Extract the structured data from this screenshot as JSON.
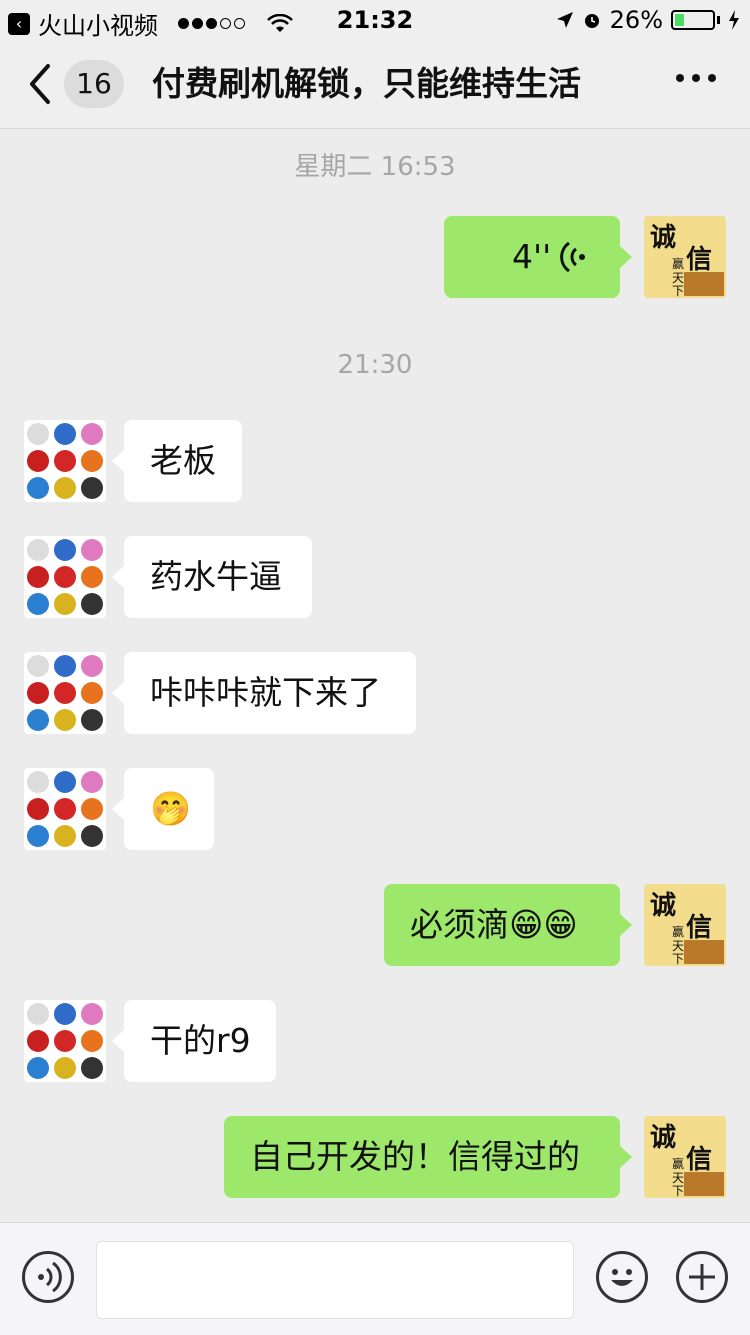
{
  "status": {
    "app_back_label": "火山小视频",
    "time": "21:32",
    "battery_text": "26%",
    "battery_level": 0.26
  },
  "nav": {
    "unread_count": "16",
    "title": "付费刷机解锁，只能维持生活"
  },
  "timestamps": [
    "星期二 16:53",
    "21:30"
  ],
  "messages": [
    {
      "side": "right",
      "type": "voice",
      "text": "4''"
    },
    {
      "side": "left",
      "type": "text",
      "text": "老板"
    },
    {
      "side": "left",
      "type": "text",
      "text": "药水牛逼"
    },
    {
      "side": "left",
      "type": "text",
      "text": "咔咔咔就下来了"
    },
    {
      "side": "left",
      "type": "emoji",
      "text": "🤭"
    },
    {
      "side": "right",
      "type": "text",
      "text": "必须滴😁😁"
    },
    {
      "side": "left",
      "type": "text",
      "text": "干的r9"
    },
    {
      "side": "right",
      "type": "text",
      "text": "自己开发的！信得过的"
    }
  ],
  "avatars": {
    "self_text_main": "诚 信",
    "self_text_sub": "赢天下"
  },
  "colors": {
    "green_bubble": "#9de86b",
    "white_bubble": "#ffffff",
    "background": "#ececec"
  },
  "icons": {
    "voice": "voice-mode-icon",
    "emoji": "emoji-face-icon",
    "plus": "plus-icon"
  }
}
